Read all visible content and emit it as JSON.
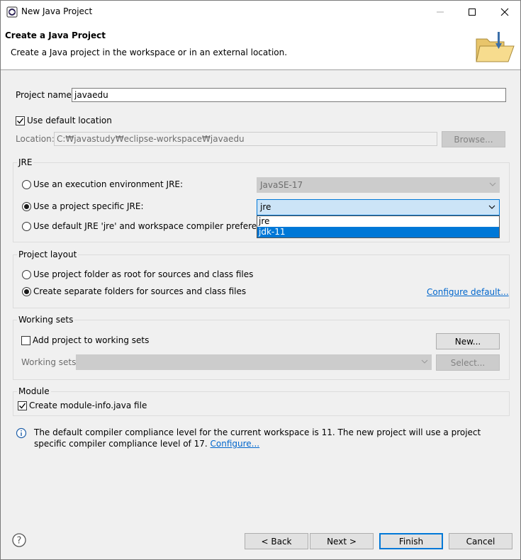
{
  "window": {
    "title": "New Java Project",
    "minimize_icon": "minimize-icon",
    "maximize_icon": "maximize-icon",
    "close_icon": "close-icon"
  },
  "header": {
    "title": "Create a Java Project",
    "description": "Create a Java project in the workspace or in an external location.",
    "banner_icon": "folder-icon"
  },
  "project": {
    "name_label": "Project name:",
    "name_value": "javaedu",
    "use_default_location_label": "Use default location",
    "use_default_location_checked": true,
    "location_label": "Location:",
    "location_value": "C:₩javastudy₩eclipse-workspace₩javaedu",
    "browse_label": "Browse..."
  },
  "jre": {
    "group_title": "JRE",
    "option_env_label": "Use an execution environment JRE:",
    "env_value": "JavaSE-17",
    "option_specific_label": "Use a project specific JRE:",
    "specific_value": "jre",
    "option_default_label": "Use default JRE 'jre' and workspace compiler preferences",
    "selected_option": "specific",
    "dropdown_options": [
      "jre",
      "jdk-11"
    ],
    "dropdown_highlighted": "jdk-11"
  },
  "layout": {
    "group_title": "Project layout",
    "option_root_label": "Use project folder as root for sources and class files",
    "option_separate_label": "Create separate folders for sources and class files",
    "selected_option": "separate",
    "configure_default_link": "Configure default..."
  },
  "working_sets": {
    "group_title": "Working sets",
    "add_label": "Add project to working sets",
    "add_checked": false,
    "new_button": "New...",
    "sets_label": "Working sets:",
    "sets_value": "",
    "select_button": "Select..."
  },
  "module": {
    "group_title": "Module",
    "create_label": "Create module-info.java file",
    "create_checked": true
  },
  "info": {
    "icon": "info-icon",
    "message": "The default compiler compliance level for the current workspace is 11. The new project will use a project specific compiler compliance level of 17.",
    "configure_link": "Configure..."
  },
  "footer": {
    "help_icon": "help-icon",
    "back_button": "< Back",
    "next_button": "Next >",
    "finish_button": "Finish",
    "cancel_button": "Cancel"
  },
  "colors": {
    "accent": "#0078d7",
    "link": "#0066cc",
    "dialog_bg": "#f0f0f0"
  }
}
